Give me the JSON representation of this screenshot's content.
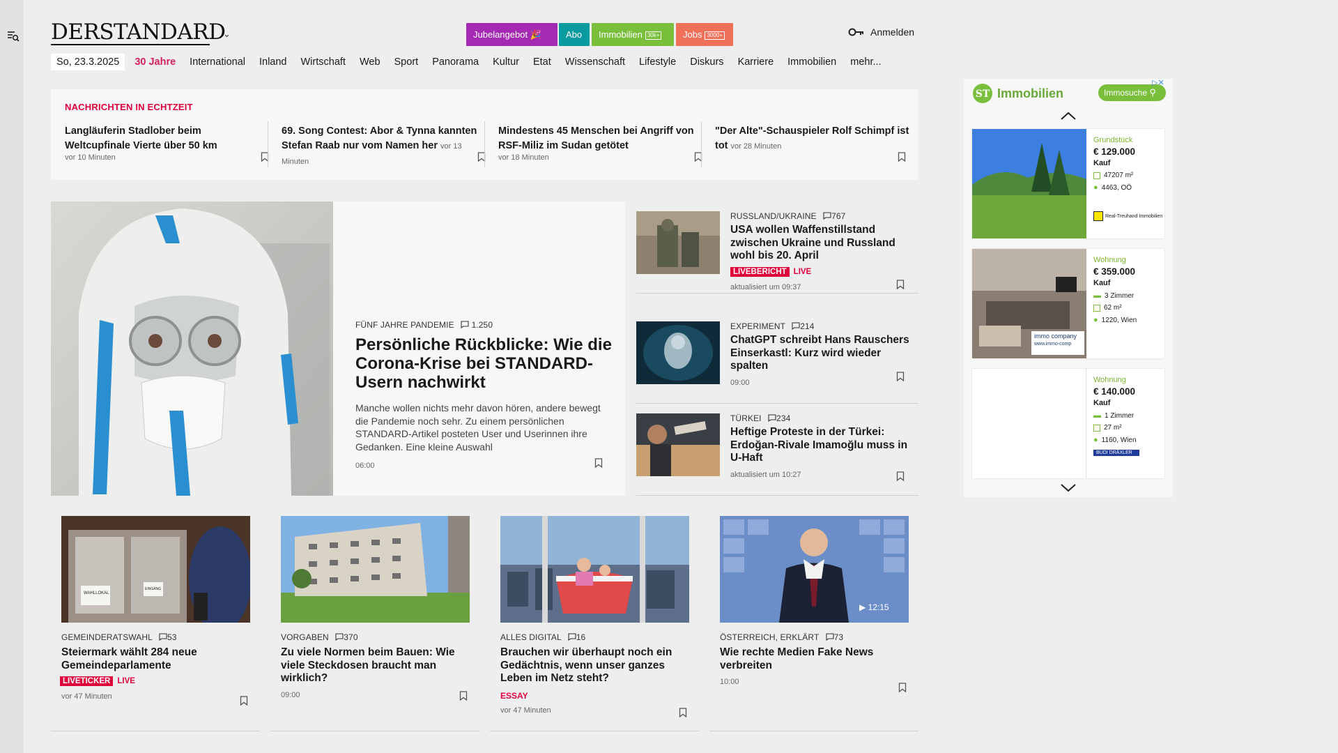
{
  "header": {
    "logo": "DERSTANDARD",
    "buttons": [
      {
        "label": "Jubelangebot",
        "color": "#a52ab3",
        "extra": "🎉"
      },
      {
        "label": "Abo",
        "color": "#0b9aa0"
      },
      {
        "label": "Immobilien",
        "color": "#79bf3b",
        "tag": "30k+"
      },
      {
        "label": "Jobs",
        "color": "#f0705a",
        "tag": "3000+"
      }
    ],
    "login": "Anmelden"
  },
  "nav": {
    "date": "So, 23.3.2025",
    "items": [
      "30 Jahre",
      "International",
      "Inland",
      "Wirtschaft",
      "Web",
      "Sport",
      "Panorama",
      "Kultur",
      "Etat",
      "Wissenschaft",
      "Lifestyle",
      "Diskurs",
      "Karriere",
      "Immobilien",
      "mehr..."
    ]
  },
  "ticker": {
    "title": "NACHRICHTEN IN ECHTZEIT",
    "items": [
      {
        "headline": "Langläuferin Stadlober beim Weltcupfinale Vierte über 50 km",
        "time": "vor 10 Minuten"
      },
      {
        "headline": "69. Song Contest: Abor & Tynna kannten Stefan Raab nur vom Namen her",
        "time": "vor 13 Minuten"
      },
      {
        "headline": "Mindestens 45 Menschen bei Angriff von RSF-Miliz im Sudan getötet",
        "time": "vor 18 Minuten"
      },
      {
        "headline": "\"Der Alte\"-Schauspieler Rolf Schimpf ist tot",
        "time": "vor 28 Minuten"
      }
    ]
  },
  "lead": {
    "kicker": "FÜNF JAHRE PANDEMIE",
    "comments": "1.250",
    "headline": "Persönliche Rückblicke: Wie die Corona-Krise bei STANDARD-Usern nachwirkt",
    "teaser": "Manche wollen nichts mehr davon hören, andere bewegt die Pandemie noch sehr. Zu einem persönlichen STANDARD-Artikel posteten User und Userinnen ihre Gedanken. Eine kleine Auswahl",
    "time": "06:00"
  },
  "side": [
    {
      "kicker": "RUSSLAND/UKRAINE",
      "comments": "767",
      "headline": "USA wollen Waffenstillstand zwischen Ukraine und Russland wohl bis 20. April",
      "badge": "LIVEBERICHT",
      "live": "LIVE",
      "time": "aktualisiert um 09:37"
    },
    {
      "kicker": "EXPERIMENT",
      "comments": "214",
      "headline": "ChatGPT schreibt Hans Rauschers Einserkastl: Kurz wird wieder spalten",
      "time": "09:00"
    },
    {
      "kicker": "TÜRKEI",
      "comments": "234",
      "headline": "Heftige Proteste in der Türkei: Erdoğan-Rivale Imamoğlu muss in U-Haft",
      "time": "aktualisiert um 10:27"
    }
  ],
  "cards": [
    {
      "kicker": "GEMEINDERATSWAHL",
      "comments": "53",
      "headline": "Steiermark wählt 284 neue Gemeindeparlamente",
      "badge": "LIVETICKER",
      "live": "LIVE",
      "time": "vor 47 Minuten",
      "sign1": "WAHLLOKAL",
      "sign2": "EINGANG"
    },
    {
      "kicker": "VORGABEN",
      "comments": "370",
      "headline": "Zu viele Normen beim Bauen: Wie viele Steckdosen braucht man wirklich?",
      "time": "09:00"
    },
    {
      "kicker": "ALLES DIGITAL",
      "comments": "16",
      "headline": "Brauchen wir überhaupt noch ein Gedächtnis, wenn unser ganzes Leben im Netz steht?",
      "essay": "ESSAY",
      "time": "vor 47 Minuten"
    },
    {
      "kicker": "ÖSTERREICH, ERKLÄRT",
      "comments": "73",
      "headline": "Wie rechte Medien Fake News verbreiten",
      "time": "10:00",
      "duration": "12:15"
    }
  ],
  "ad": {
    "brand": "Immobilien",
    "search": "Immosuche",
    "listings": [
      {
        "type": "Grundstück",
        "price": "€ 129.000",
        "deal": "Kauf",
        "area": "47207 m²",
        "location": "4463, OÖ",
        "agent": "Real-Treuhand Immobilien"
      },
      {
        "type": "Wohnung",
        "price": "€ 359.000",
        "deal": "Kauf",
        "rooms": "3 Zimmer",
        "area": "62 m²",
        "location": "1220, Wien",
        "agent": "immo company",
        "agent_url": "www.immo-comp"
      },
      {
        "type": "Wohnung",
        "price": "€ 140.000",
        "deal": "Kauf",
        "rooms": "1 Zimmer",
        "area": "27 m²",
        "location": "1160, Wien",
        "agent": "BUDI DRÄXLER"
      }
    ]
  }
}
